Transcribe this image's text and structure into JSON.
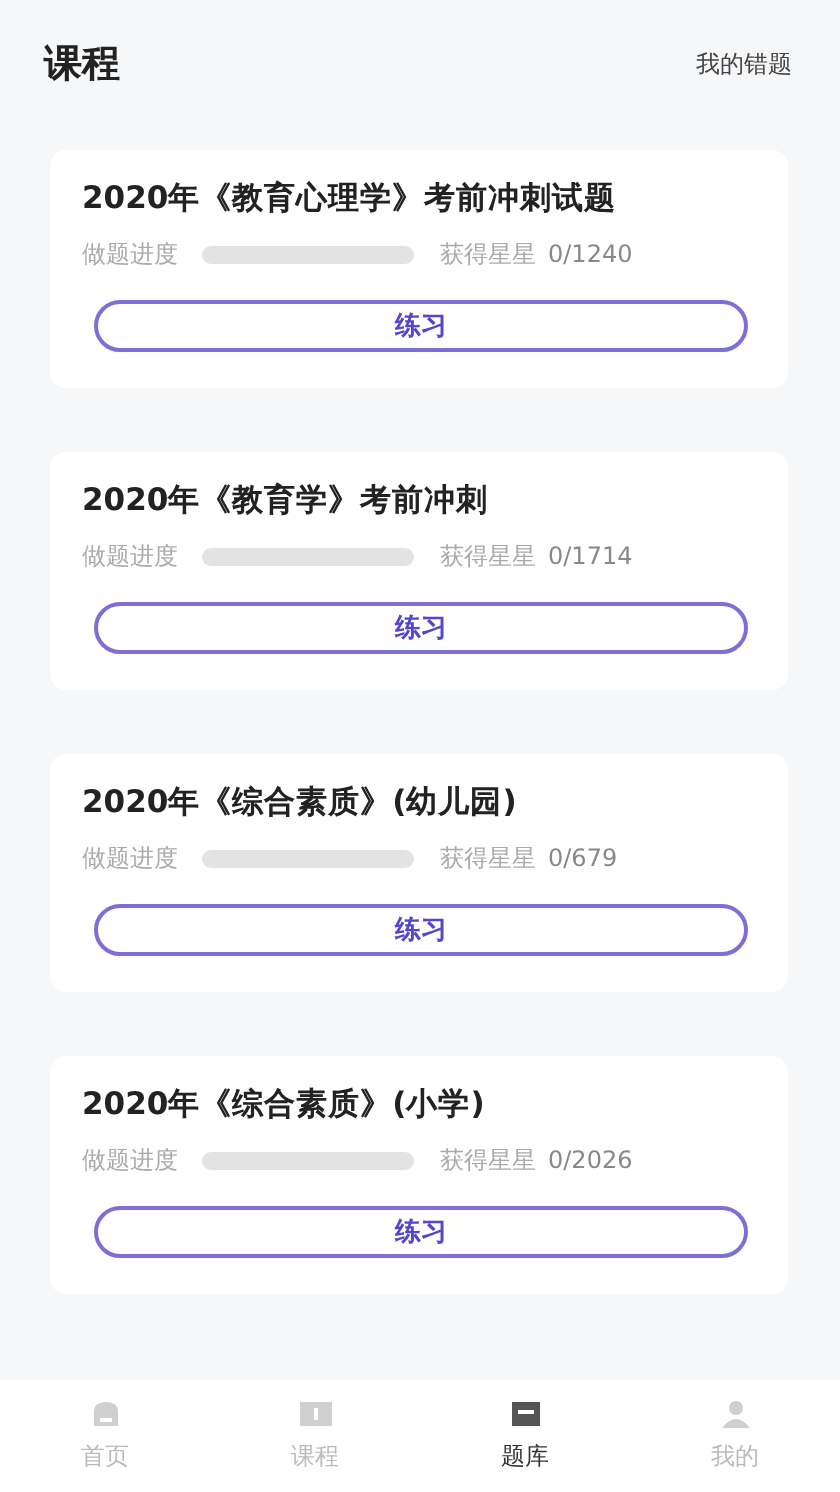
{
  "header": {
    "title": "课程",
    "link": "我的错题"
  },
  "courses": [
    {
      "title": "2020年《教育心理学》考前冲刺试题",
      "progress_label": "做题进度",
      "level": 0,
      "stars_label": "获得星星",
      "stars_count": "0/1240",
      "button": "练习"
    },
    {
      "title": "2020年《教育学》考前冲刺",
      "progress_label": "做题进度",
      "level": 0,
      "stars_label": "获得星星",
      "stars_count": "0/1714",
      "button": "练习"
    },
    {
      "title": "2020年《综合素质》(幼儿园)",
      "progress_label": "做题进度",
      "level": 0,
      "stars_label": "获得星星",
      "stars_count": "0/679",
      "button": "练习"
    },
    {
      "title": "2020年《综合素质》(小学)",
      "progress_label": "做题进度",
      "level": 0,
      "stars_label": "获得星星",
      "stars_count": "0/2026",
      "button": "练习"
    }
  ],
  "tab_bar": [
    {
      "kind": "home",
      "label": "首页",
      "selected": false
    },
    {
      "kind": "course",
      "label": "课程",
      "selected": false
    },
    {
      "kind": "bank",
      "label": "题库",
      "selected": true
    },
    {
      "kind": "mine",
      "label": "我的",
      "selected": false
    }
  ]
}
